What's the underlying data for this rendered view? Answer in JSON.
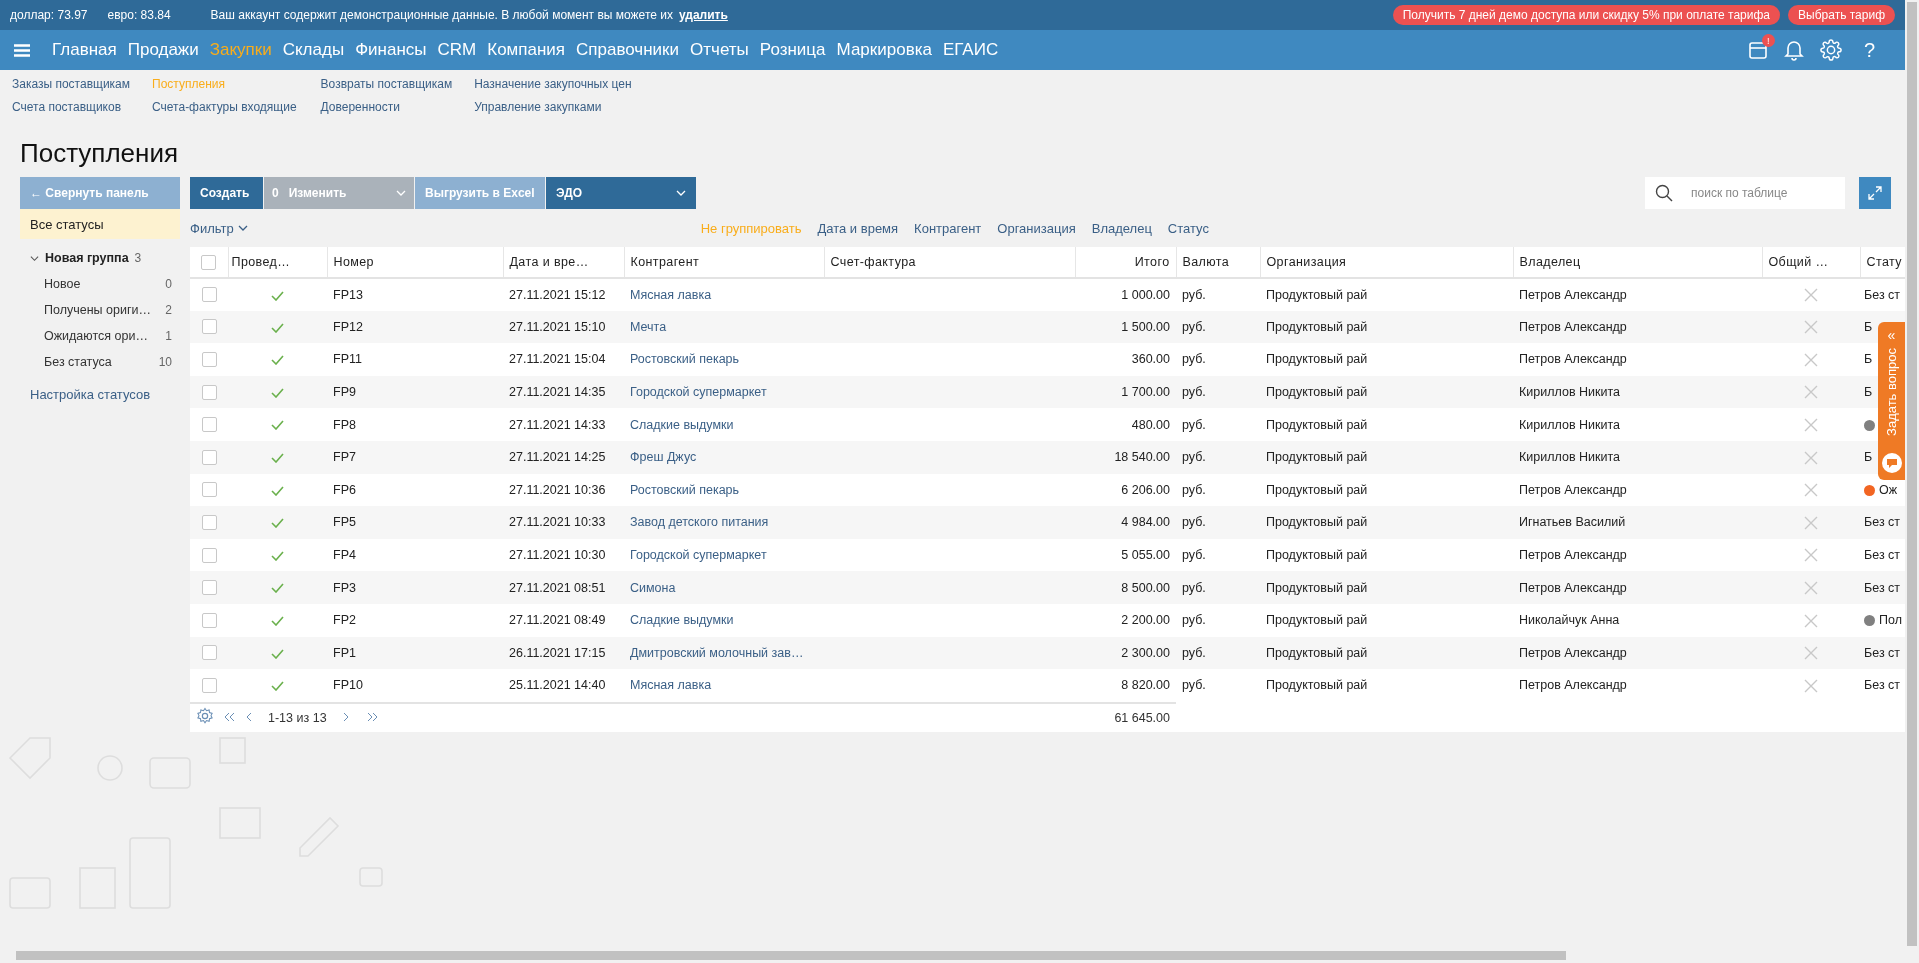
{
  "top_bar": {
    "rates": [
      {
        "label": "доллар:",
        "value": "73.97"
      },
      {
        "label": "евро:",
        "value": "83.84"
      }
    ],
    "notice": "Ваш аккаунт содержит демонстрационные данные. В любой момент вы можете их",
    "notice_link": "удалить",
    "promo_button": "Получить 7 дней демо доступа или скидку 5% при оплате тарифа",
    "tariff_button": "Выбрать тариф"
  },
  "nav": {
    "items": [
      {
        "label": "Главная",
        "selected": false
      },
      {
        "label": "Продажи",
        "selected": false
      },
      {
        "label": "Закупки",
        "selected": true
      },
      {
        "label": "Склады",
        "selected": false
      },
      {
        "label": "Финансы",
        "selected": false
      },
      {
        "label": "CRM",
        "selected": false
      },
      {
        "label": "Компания",
        "selected": false
      },
      {
        "label": "Справочники",
        "selected": false
      },
      {
        "label": "Отчеты",
        "selected": false
      },
      {
        "label": "Розница",
        "selected": false
      },
      {
        "label": "Маркировка",
        "selected": false
      },
      {
        "label": "ЕГАИС",
        "selected": false
      }
    ],
    "calendar_badge": "!",
    "help": "?"
  },
  "submenu": {
    "columns": [
      [
        {
          "label": "Заказы поставщикам",
          "selected": false
        },
        {
          "label": "Счета поставщиков",
          "selected": false
        }
      ],
      [
        {
          "label": "Поступления",
          "selected": true
        },
        {
          "label": "Счета-фактуры входящие",
          "selected": false
        }
      ],
      [
        {
          "label": "Возвраты поставщикам",
          "selected": false
        },
        {
          "label": "Доверенности",
          "selected": false
        }
      ],
      [
        {
          "label": "Назначение закупочных цен",
          "selected": false
        },
        {
          "label": "Управление закупками",
          "selected": false
        }
      ]
    ]
  },
  "page_title": "Поступления",
  "sidebar": {
    "collapse_button": "← Свернуть панель",
    "all_statuses": {
      "label": "Все статусы",
      "selected": true
    },
    "groups": [
      {
        "label": "Новая группа",
        "count": "3",
        "expanded": true,
        "children": [
          {
            "label": "Новое",
            "count": "0"
          },
          {
            "label": "Получены ориги…",
            "count": "2"
          },
          {
            "label": "Ожидаются ори…",
            "count": "1"
          },
          {
            "label": "Без статуса",
            "count": "10"
          }
        ]
      }
    ],
    "settings_link": "Настройка статусов"
  },
  "toolbar": {
    "create": "Создать",
    "edit": {
      "count": "0",
      "label": "Изменить",
      "disabled": true
    },
    "export": "Выгрузить в Excel",
    "edo": "ЭДО",
    "search": {
      "placeholder": "поиск по таблице"
    }
  },
  "filter": "Фильтр",
  "grouping": [
    {
      "label": "Не группировать",
      "selected": true
    },
    {
      "label": "Дата и время",
      "selected": false
    },
    {
      "label": "Контрагент",
      "selected": false
    },
    {
      "label": "Организация",
      "selected": false
    },
    {
      "label": "Владелец",
      "selected": false
    },
    {
      "label": "Статус",
      "selected": false
    }
  ],
  "table": {
    "select_all_checked": false,
    "columns": [
      "Провед…",
      "Номер",
      "Дата и вре…",
      "Контрагент",
      "Счет-фактура",
      "Итого",
      "Валюта",
      "Организация",
      "Владелец",
      "Общий …",
      "Стату"
    ],
    "rows": [
      {
        "checked": false,
        "posted": true,
        "number": "FP13",
        "date": "27.11.2021 15:12",
        "counterparty": "Мясная лавка",
        "total": "1 000.00",
        "currency": "руб.",
        "organization": "Продуктовый рай",
        "owner": "Петров Александр",
        "shared": false,
        "status": "Без ст"
      },
      {
        "checked": false,
        "posted": true,
        "number": "FP12",
        "date": "27.11.2021 15:10",
        "counterparty": "Мечта",
        "total": "1 500.00",
        "currency": "руб.",
        "organization": "Продуктовый рай",
        "owner": "Петров Александр",
        "shared": false,
        "status": "Б"
      },
      {
        "checked": false,
        "posted": true,
        "number": "FP11",
        "date": "27.11.2021 15:04",
        "counterparty": "Ростовский пекарь",
        "total": "360.00",
        "currency": "руб.",
        "organization": "Продуктовый рай",
        "owner": "Петров Александр",
        "shared": false,
        "status": "Б"
      },
      {
        "checked": false,
        "posted": true,
        "number": "FP9",
        "date": "27.11.2021 14:35",
        "counterparty": "Городской супермаркет",
        "total": "1 700.00",
        "currency": "руб.",
        "organization": "Продуктовый рай",
        "owner": "Кириллов Никита",
        "shared": false,
        "status": "Б"
      },
      {
        "checked": false,
        "posted": true,
        "number": "FP8",
        "date": "27.11.2021 14:33",
        "counterparty": "Сладкие выдумки",
        "total": "480.00",
        "currency": "руб.",
        "organization": "Продуктовый рай",
        "owner": "Кириллов Никита",
        "shared": false,
        "color": "#808080"
      },
      {
        "checked": false,
        "posted": true,
        "number": "FP7",
        "date": "27.11.2021 14:25",
        "counterparty": "Фреш Джус",
        "total": "18 540.00",
        "currency": "руб.",
        "organization": "Продуктовый рай",
        "owner": "Кириллов Никита",
        "shared": false,
        "status": "Б"
      },
      {
        "checked": false,
        "posted": true,
        "number": "FP6",
        "date": "27.11.2021 10:36",
        "counterparty": "Ростовский пекарь",
        "total": "6 206.00",
        "currency": "руб.",
        "organization": "Продуктовый рай",
        "owner": "Петров Александр",
        "shared": false,
        "status": "Ож",
        "color": "#f26522"
      },
      {
        "checked": false,
        "posted": true,
        "number": "FP5",
        "date": "27.11.2021 10:33",
        "counterparty": "Завод детского питания",
        "total": "4 984.00",
        "currency": "руб.",
        "organization": "Продуктовый рай",
        "owner": "Игнатьев Василий",
        "shared": false,
        "status": "Без ст"
      },
      {
        "checked": false,
        "posted": true,
        "number": "FP4",
        "date": "27.11.2021 10:30",
        "counterparty": "Городской супермаркет",
        "total": "5 055.00",
        "currency": "руб.",
        "organization": "Продуктовый рай",
        "owner": "Петров Александр",
        "shared": false,
        "status": "Без ст"
      },
      {
        "checked": false,
        "posted": true,
        "number": "FP3",
        "date": "27.11.2021 08:51",
        "counterparty": "Симона",
        "total": "8 500.00",
        "currency": "руб.",
        "organization": "Продуктовый рай",
        "owner": "Петров Александр",
        "shared": false,
        "status": "Без ст"
      },
      {
        "checked": false,
        "posted": true,
        "number": "FP2",
        "date": "27.11.2021 08:49",
        "counterparty": "Сладкие выдумки",
        "total": "2 200.00",
        "currency": "руб.",
        "organization": "Продуктовый рай",
        "owner": "Николайчук Анна",
        "shared": false,
        "status": "Пол",
        "color": "#808080"
      },
      {
        "checked": false,
        "posted": true,
        "number": "FP1",
        "date": "26.11.2021 17:15",
        "counterparty": "Дмитровский молочный зав…",
        "total": "2 300.00",
        "currency": "руб.",
        "organization": "Продуктовый рай",
        "owner": "Петров Александр",
        "shared": false,
        "status": "Без ст"
      },
      {
        "checked": false,
        "posted": true,
        "number": "FP10",
        "date": "25.11.2021 14:40",
        "counterparty": "Мясная лавка",
        "total": "8 820.00",
        "currency": "руб.",
        "organization": "Продуктовый рай",
        "owner": "Петров Александр",
        "shared": false,
        "status": "Без ст"
      }
    ],
    "pagination": "1-13 из 13",
    "sum": "61 645.00"
  },
  "question_tab": {
    "arrow": "«",
    "label": "Задать вопрос"
  }
}
